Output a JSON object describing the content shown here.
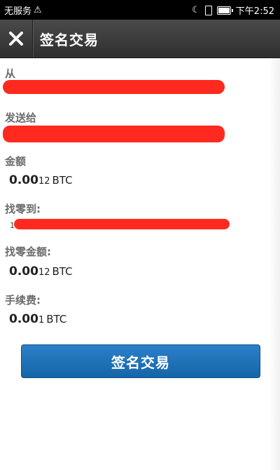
{
  "status_bar": {
    "carrier": "无服务",
    "warning_icon": "warning-icon",
    "time": "下午2:52",
    "icons": [
      "moon-icon",
      "sim-card-icon",
      "battery-icon"
    ],
    "battery_level": 0.9
  },
  "header": {
    "title": "签名交易",
    "close_icon": "close-icon"
  },
  "form": {
    "from_label": "从",
    "to_label": "发送给",
    "amount_label": "金额",
    "amount_big": "0.00",
    "amount_small": "12",
    "amount_unit": "BTC",
    "change_to_label": "找零到:",
    "change_addr_prefix": "1",
    "change_amount_label": "找零金额:",
    "change_big": "0.00",
    "change_small": "12",
    "change_unit": "BTC",
    "fee_label": "手续费:",
    "fee_big": "0.00",
    "fee_small": "1",
    "fee_unit": "BTC"
  },
  "actions": {
    "sign_button_label": "签名交易"
  },
  "colors": {
    "redaction": "#ff2a1f",
    "button": "#1d6fb8",
    "titlebar": "#3a3a3a"
  }
}
